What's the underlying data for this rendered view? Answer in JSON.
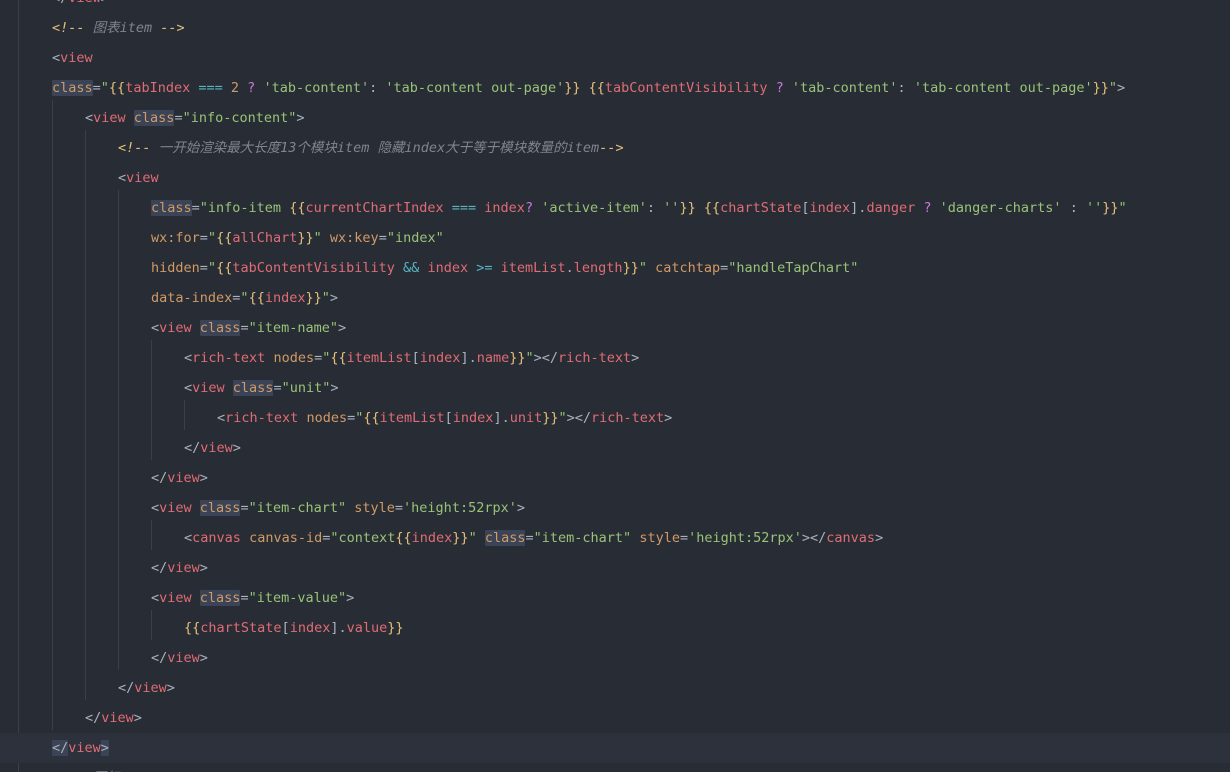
{
  "editor": {
    "lines": [
      "</view>",
      "<!-- 图表item -->",
      "<view",
      "class=\"{{tabIndex === 2 ? 'tab-content': 'tab-content out-page'}} {{tabContentVisibility ? 'tab-content': 'tab-content out-page'}}\">",
      "<view class=\"info-content\">",
      "<!-- 一开始渲染最大长度13个模块item 隐藏index大于等于模块数量的item-->",
      "<view",
      "class=\"info-item {{currentChartIndex === index? 'active-item': ''}} {{chartState[index].danger ? 'danger-charts' : ''}}\"",
      "wx:for=\"{{allChart}}\" wx:key=\"index\"",
      "hidden=\"{{tabContentVisibility && index >= itemList.length}}\" catchtap=\"handleTapChart\"",
      "data-index=\"{{index}}\">",
      "<view class=\"item-name\">",
      "<rich-text nodes=\"{{itemList[index].name}}\"></rich-text>",
      "<view class=\"unit\">",
      "<rich-text nodes=\"{{itemList[index].unit}}\"></rich-text>",
      "</view>",
      "</view>",
      "<view class=\"item-chart\" style='height:52rpx'>",
      "<canvas canvas-id=\"context{{index}}\" class=\"item-chart\" style='height:52rpx'></canvas>",
      "</view>",
      "<view class=\"item-value\">",
      "{{chartState[index].value}}",
      "</view>",
      "</view>",
      "</view>",
      "</view>",
      "<!-- 图标tab -->"
    ]
  }
}
